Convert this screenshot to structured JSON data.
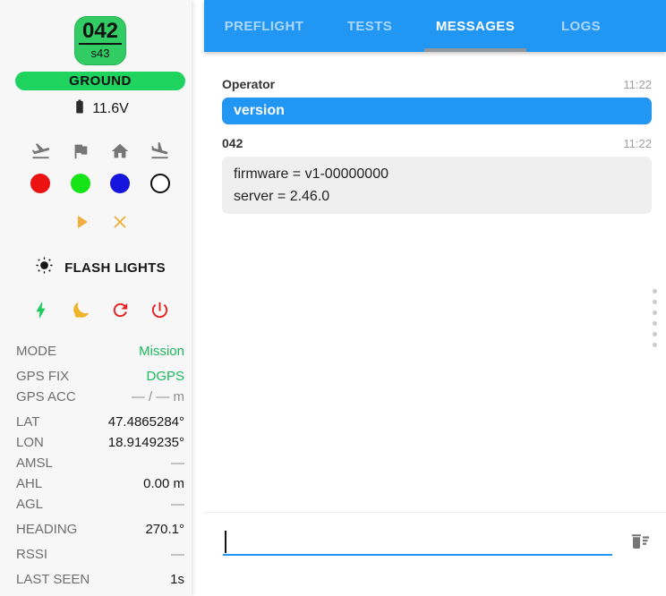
{
  "colors": {
    "accent_blue": "#2196f3",
    "badge_green": "#31cd64",
    "pill_green": "#1fd35f",
    "value_green": "#1cb85c",
    "led_red": "#ed1212",
    "led_green": "#17e417",
    "led_blue": "#1515dd",
    "amber": "#f2ac38",
    "icon_gray": "#767676",
    "danger_red": "#e81d1d",
    "bolt_green": "#1ecb5a",
    "tab_indicator": "#8f9599"
  },
  "icons": {
    "takeoff": "flight-takeoff-icon",
    "flag": "flag-icon",
    "home": "home-icon",
    "land": "flight-land-icon",
    "play": "play-icon",
    "cancel": "x-icon",
    "sun": "sun-flash-icon",
    "bolt": "lightning-bolt-icon",
    "sleep": "moon-sleep-icon",
    "reboot": "refresh-icon",
    "power": "power-icon",
    "battery": "battery-icon",
    "clear_log": "delete-sweep-icon",
    "drag": "drag-handle-dots"
  },
  "drone": {
    "id": "042",
    "sub_id": "s43",
    "status": "GROUND",
    "battery_voltage": "11.6V",
    "flash_lights_label": "FLASH LIGHTS"
  },
  "telemetry": {
    "rows": [
      {
        "label": "MODE",
        "value": "Mission"
      },
      {
        "label": "GPS FIX",
        "value": "DGPS"
      },
      {
        "label": "GPS ACC",
        "value": "— / — m"
      },
      {
        "label": "LAT",
        "value": "47.4865284°"
      },
      {
        "label": "LON",
        "value": "18.9149235°"
      },
      {
        "label": "AMSL",
        "value": "—"
      },
      {
        "label": "AHL",
        "value": "0.00 m"
      },
      {
        "label": "AGL",
        "value": "—"
      },
      {
        "label": "HEADING",
        "value": "270.1°"
      },
      {
        "label": "RSSI",
        "value": "—"
      },
      {
        "label": "LAST SEEN",
        "value": "1s"
      }
    ]
  },
  "tabs": [
    {
      "label": "PREFLIGHT",
      "active": false
    },
    {
      "label": "TESTS",
      "active": false
    },
    {
      "label": "MESSAGES",
      "active": true
    },
    {
      "label": "LOGS",
      "active": false
    }
  ],
  "messages": [
    {
      "sender": "Operator",
      "time": "11:22",
      "text": "version",
      "kind": "outgoing"
    },
    {
      "sender": "042",
      "time": "11:22",
      "line1": "firmware = v1-00000000",
      "line2": "server = 2.46.0",
      "kind": "incoming"
    }
  ],
  "composer": {
    "value": "",
    "placeholder": ""
  }
}
